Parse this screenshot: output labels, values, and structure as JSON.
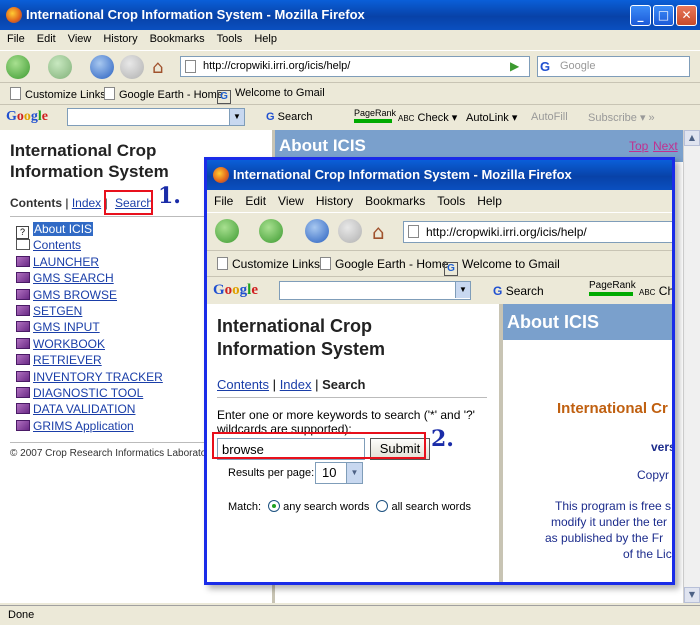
{
  "outer": {
    "title": "International Crop Information System - Mozilla Firefox",
    "menu": [
      "File",
      "Edit",
      "View",
      "History",
      "Bookmarks",
      "Tools",
      "Help"
    ],
    "url": "http://cropwiki.irri.org/icis/help/",
    "search_placeholder": "Google",
    "bookmarks": [
      "Customize Links",
      "Google Earth - Home",
      "Welcome to Gmail"
    ],
    "google_toolbar": {
      "search": "Search",
      "pagerank": "PageRank",
      "check": "Check",
      "autolink": "AutoLink",
      "autofill": "AutoFill",
      "subscribe": "Subscribe"
    },
    "status": "Done"
  },
  "left_pane": {
    "title_line1": "International Crop",
    "title_line2": "Information System",
    "contents_label": "Contents",
    "sep": "|",
    "index_label": "Index",
    "search_label": "Search",
    "tree": [
      "About ICIS",
      "Contents",
      "LAUNCHER",
      "GMS SEARCH",
      "GMS BROWSE",
      "SETGEN",
      "GMS INPUT",
      "WORKBOOK",
      "RETRIEVER",
      "INVENTORY TRACKER",
      "DIAGNOSTIC TOOL",
      "DATA VALIDATION",
      "GRIMS Application"
    ],
    "copyright": "© 2007 Crop Research Informatics Laborato"
  },
  "right_pane": {
    "heading": "About ICIS",
    "top_link": "Top",
    "next_link": "Next"
  },
  "annotations": {
    "step1": "1.",
    "step2": "2."
  },
  "inner": {
    "title": "International Crop Information System - Mozilla Firefox",
    "menu": [
      "File",
      "Edit",
      "View",
      "History",
      "Bookmarks",
      "Tools",
      "Help"
    ],
    "url": "http://cropwiki.irri.org/icis/help/",
    "bookmarks": [
      "Customize Links",
      "Google Earth - Home",
      "Welcome to Gmail"
    ],
    "google_toolbar": {
      "search": "Search",
      "pagerank": "PageRank",
      "check": "Check"
    },
    "left": {
      "title_line1": "International Crop",
      "title_line2": "Information System",
      "contents_label": "Contents",
      "index_label": "Index",
      "search_label": "Search",
      "instructions": "Enter one or more keywords to search ('*' and '?' wildcards are supported):",
      "query": "browse",
      "submit": "Submit",
      "results_label": "Results per page:",
      "results_value": "10",
      "match_label": "Match:",
      "match_any": "any search words",
      "match_all": "all search words"
    },
    "right": {
      "heading": "About ICIS",
      "line1": "International Cr",
      "line2": "vers",
      "line3": "Copyr",
      "para1": "This program is free s",
      "para2": "modify it under the ter",
      "para3": "as published by the Fr",
      "para4": "of the Lic"
    }
  },
  "colors": {
    "annotation_blue": "#1a2ca8",
    "highlight_red": "#e8101c",
    "header_blue": "#7aa0cc",
    "link_blue": "#1a3ea8"
  }
}
